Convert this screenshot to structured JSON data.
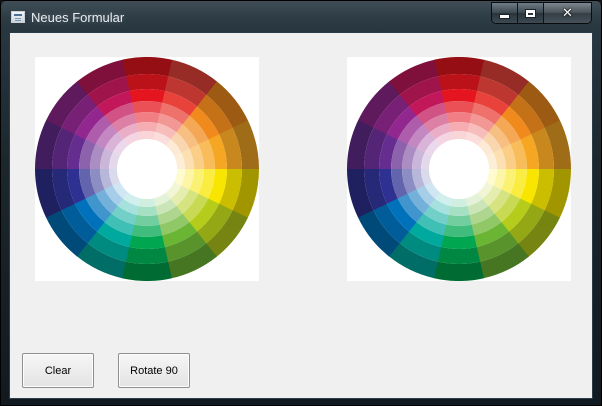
{
  "window": {
    "title": "Neues Formular",
    "icon": "form-window-icon"
  },
  "caption_buttons": {
    "minimize_icon": "minimize-icon",
    "maximize_icon": "maximize-icon",
    "close_glyph": "✕"
  },
  "pictures": [
    {
      "name": "color-wheel-image-left",
      "content": "color wheel"
    },
    {
      "name": "color-wheel-image-right",
      "content": "color wheel"
    }
  ],
  "buttons": {
    "clear_label": "Clear",
    "rotate_label": "Rotate 90"
  },
  "colors": {
    "wheel_hues": [
      "#e4151f",
      "#e8423a",
      "#f08a1c",
      "#f5a623",
      "#f8e600",
      "#b5cc1a",
      "#6bb534",
      "#00a650",
      "#00a99d",
      "#0072bc",
      "#2e3192",
      "#662d91",
      "#92278f",
      "#c2185b"
    ],
    "client_background": "#f0f0f0"
  }
}
